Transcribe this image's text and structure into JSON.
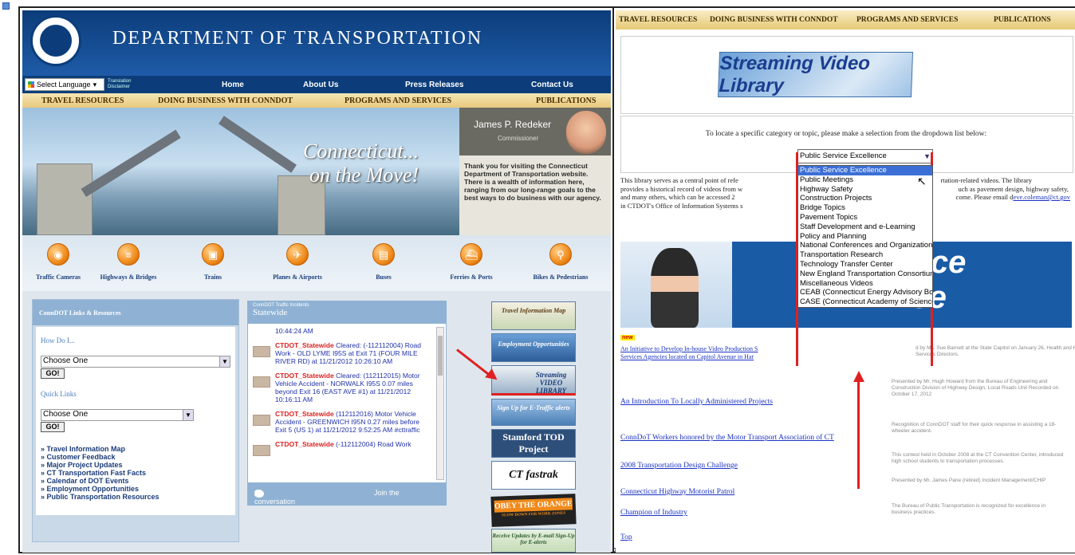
{
  "left": {
    "header_title": "DEPARTMENT OF TRANSPORTATION",
    "language_select": "Select Language",
    "translation_disclaimer": "Translation Disclaimer",
    "nav": [
      "Home",
      "About Us",
      "Press Releases",
      "Contact Us"
    ],
    "subnav": [
      "TRAVEL RESOURCES",
      "DOING BUSINESS WITH CONNDOT",
      "PROGRAMS AND SERVICES",
      "PUBLICATIONS"
    ],
    "hero_line1": "Connecticut...",
    "hero_line2": "on the Move!",
    "commissioner_name": "James P. Redeker",
    "commissioner_title": "Commissioner",
    "commissioner_msg": "Thank you for visiting the Connecticut Department of Transportation website. There is a wealth of information here, ranging from our long-range goals to the best ways to do business with our agency.",
    "modes": [
      "Traffic Cameras",
      "Highways & Bridges",
      "Trains",
      "Planes & Airports",
      "Buses",
      "Ferries & Ports",
      "Bikes & Pedestrians"
    ],
    "links_panel_title": "ConnDOT Links & Resources",
    "how_do_i": "How Do I...",
    "choose_one": "Choose One",
    "go": "GO!",
    "quick_links": "Quick Links",
    "bullets": [
      "Travel Information Map",
      "Customer Feedback",
      "Major Project Updates",
      "CT Transportation Fast Facts",
      "Calendar of DOT Events",
      "Employment Opportunities",
      "Public Transportation Resources"
    ],
    "incidents_label": "ConnDOT Traffic Incidents",
    "incidents_title": "Statewide",
    "incident_top_time": "10:44:24 AM",
    "incidents": [
      {
        "source": "CTDOT_Statewide",
        "text": "Cleared: (-112112004) Road Work - OLD LYME I95S at Exit 71 (FOUR MILE RIVER RD) at 11/21/2012 10:26:10 AM"
      },
      {
        "source": "CTDOT_Statewide",
        "text": "Cleared: (112112015) Motor Vehicle Accident - NORWALK I95S 0.07 miles beyond Exit 16 (EAST AVE #1) at 11/21/2012 10:16:11 AM"
      },
      {
        "source": "CTDOT_Statewide",
        "text": "(112112016) Motor Vehicle Accident - GREENWICH I95N 0.27 miles before Exit 5 (US 1) at 11/21/2012 9:52:25 AM #cttraffic"
      },
      {
        "source": "CTDOT_Statewide",
        "text": "(-112112004) Road Work"
      }
    ],
    "join_conversation": "Join the conversation",
    "promos": [
      "Travel Information Map",
      "Employment Opportunities",
      "Streaming VIDEO LIBRARY",
      "Sign Up for E-Traffic alerts",
      "Stamford TOD Project",
      "CT fastrak",
      "OBEY THE ORANGE",
      "Receive Updates by E-mail Sign-Up for E-alerts"
    ],
    "obey_sub": "SLOW DOWN FOR WORK ZONES"
  },
  "right": {
    "subnav": [
      "TRAVEL RESOURCES",
      "DOING BUSINESS WITH CONNDOT",
      "PROGRAMS AND SERVICES",
      "PUBLICATIONS"
    ],
    "library_title": "Streaming Video Library",
    "instruction": "To locate a specific category or topic, please make a selection from the dropdown list below:",
    "dropdown_selected": "Public Service Excellence",
    "dropdown_options": [
      "Public Service Excellence",
      "Public Meetings",
      "Highway Safety",
      "Construction Projects",
      "Bridge Topics",
      "Pavement Topics",
      "Staff Development and e-Learning",
      "Policy and Planning",
      "National Conferences and Organizations",
      "Transportation Research",
      "Technology Transfer Center",
      "New England Transportation Consortium",
      "Miscellaneous Videos",
      "CEAB (Connecticut Energy Advisory Board)",
      "CASE (Connecticut Academy of Science and"
    ],
    "description_a": "This library serves as a central point of refe",
    "description_b": "provides a historical record of videos from w",
    "description_c": "and many others, which can be accessed 2",
    "description_d": "in CTDOT's Office of Information Systems s",
    "description_r1": "rtation-related videos. The library",
    "description_r2": "uch as pavement design, highway safety,",
    "description_r3": "come. Please email d",
    "email": "eve.coleman@ct.gov",
    "banner_line1": "rvice",
    "banner_line2": "nce",
    "new_badge": "new",
    "videos": [
      {
        "title": "An Initiative to Develop In-house Video Production S",
        "title2": "Services Agencies located on Capitol Avenue in Har",
        "desc": "d by Ms. Sue Barnett at the State Capitol on January 26, Health and Human Services Directors."
      },
      {
        "title": "An Introduction To Locally Administered Projects",
        "desc": "Presented by Mr. Hugh Howard from the Bureau of Engineering and Construction Division of Highway Design, Local Roads Unit Recorded on October 17, 2012"
      },
      {
        "title": "ConnDoT Workers honored by the Motor Transport Association of CT",
        "desc": "Recognition of ConnDOT staff for their quick response in assisting a 18-wheeler accident."
      },
      {
        "title": "2008 Transportation Design Challenge",
        "desc": "This contest held in October 2008 at the CT Convention Center, introduced high school students to transportation processes."
      },
      {
        "title": "Connecticut Highway Motorist Patrol",
        "desc": "Presented by Mr. James Pane (retired) Incident Management/CHIP"
      },
      {
        "title": "Champion of Industry",
        "desc": "The Bureau of Public Transportation is recognized for excellence in business practices."
      },
      {
        "title": "Top",
        "desc": ""
      }
    ]
  },
  "colors": {
    "dot_blue": "#0c3d7a",
    "gold_nav": "#e6c976",
    "highlight": "#3b6fd6",
    "annotation_red": "#e02020",
    "link_blue": "#1a32c4"
  }
}
